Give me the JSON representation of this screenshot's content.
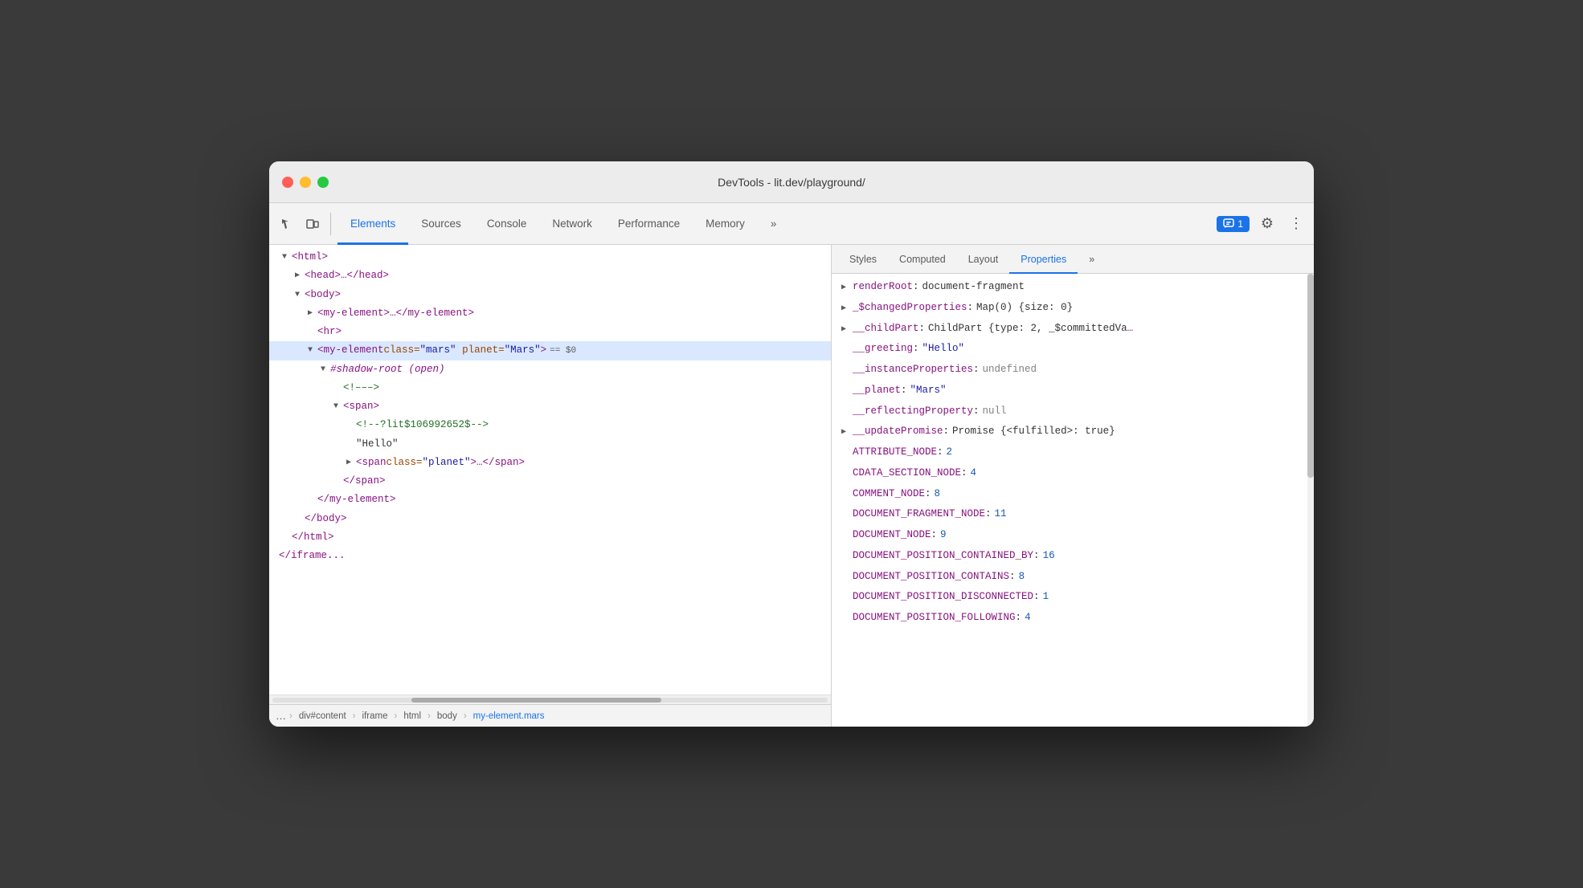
{
  "window": {
    "title": "DevTools - lit.dev/playground/"
  },
  "toolbar": {
    "tabs": [
      {
        "label": "Elements",
        "active": true
      },
      {
        "label": "Sources",
        "active": false
      },
      {
        "label": "Console",
        "active": false
      },
      {
        "label": "Network",
        "active": false
      },
      {
        "label": "Performance",
        "active": false
      },
      {
        "label": "Memory",
        "active": false
      },
      {
        "label": "»",
        "active": false
      }
    ],
    "chat_badge": "1",
    "more_tabs": "»"
  },
  "elements_panel": {
    "tree": [
      {
        "indent": 0,
        "triangle": "▼",
        "content_type": "tag",
        "tag": "html",
        "close": false
      },
      {
        "indent": 1,
        "triangle": "▶",
        "content_type": "tag",
        "tag": "head",
        "text": "<head>…</head>"
      },
      {
        "indent": 1,
        "triangle": "▼",
        "content_type": "tag",
        "tag": "body"
      },
      {
        "indent": 2,
        "triangle": "▶",
        "content_type": "tag",
        "tag": "my-element",
        "text": "<my-element>…</my-element>"
      },
      {
        "indent": 2,
        "triangle": " ",
        "content_type": "tag",
        "tag": "hr"
      },
      {
        "indent": 2,
        "triangle": "▼",
        "content_type": "selected_tag",
        "selected": true
      },
      {
        "indent": 3,
        "triangle": "▼",
        "content_type": "shadow_root"
      },
      {
        "indent": 4,
        "triangle": " ",
        "content_type": "comment",
        "text": "<!–––>"
      },
      {
        "indent": 4,
        "triangle": "▼",
        "content_type": "tag",
        "tag": "span"
      },
      {
        "indent": 5,
        "triangle": " ",
        "content_type": "comment",
        "text": "<!--?lit$106992652$-->"
      },
      {
        "indent": 5,
        "triangle": " ",
        "content_type": "text",
        "text": "\"Hello\""
      },
      {
        "indent": 5,
        "triangle": "▶",
        "content_type": "tag_attr",
        "tag": "span",
        "attr_name": "class",
        "attr_value": "planet",
        "text": "<span class=\"planet\">…</span>"
      },
      {
        "indent": 4,
        "triangle": " ",
        "content_type": "close_tag",
        "tag": "span"
      },
      {
        "indent": 3,
        "triangle": " ",
        "content_type": "close_tag",
        "tag": "my-element"
      },
      {
        "indent": 2,
        "triangle": " ",
        "content_type": "close_tag",
        "tag": "body"
      },
      {
        "indent": 1,
        "triangle": " ",
        "content_type": "close_tag",
        "tag": "html"
      },
      {
        "indent": 0,
        "triangle": " ",
        "content_type": "close_tag_partial",
        "tag": "iframe"
      }
    ],
    "breadcrumb": {
      "items": [
        {
          "label": "…",
          "type": "more"
        },
        {
          "label": "div#content",
          "type": "normal"
        },
        {
          "label": "iframe",
          "type": "normal"
        },
        {
          "label": "html",
          "type": "normal"
        },
        {
          "label": "body",
          "type": "normal"
        },
        {
          "label": "my-element.mars",
          "type": "active"
        }
      ],
      "more_label": "…"
    }
  },
  "properties_panel": {
    "tabs": [
      {
        "label": "Styles",
        "active": false
      },
      {
        "label": "Computed",
        "active": false
      },
      {
        "label": "Layout",
        "active": false
      },
      {
        "label": "Properties",
        "active": true
      },
      {
        "label": "»",
        "active": false
      }
    ],
    "properties": [
      {
        "has_triangle": true,
        "key": "renderRoot",
        "value": "document-fragment",
        "value_type": "plain"
      },
      {
        "has_triangle": true,
        "key": "_$changedProperties",
        "value": "Map(0) {size: 0}",
        "value_type": "plain"
      },
      {
        "has_triangle": true,
        "key": "__childPart",
        "value": "ChildPart {type: 2, _$committedVa…",
        "value_type": "plain"
      },
      {
        "has_triangle": false,
        "key": "__greeting",
        "value": "\"Hello\"",
        "value_type": "string"
      },
      {
        "has_triangle": false,
        "key": "__instanceProperties",
        "value": "undefined",
        "value_type": "null"
      },
      {
        "has_triangle": false,
        "key": "__planet",
        "value": "\"Mars\"",
        "value_type": "string"
      },
      {
        "has_triangle": false,
        "key": "__reflectingProperty",
        "value": "null",
        "value_type": "null"
      },
      {
        "has_triangle": true,
        "key": "__updatePromise",
        "value": "Promise {<fulfilled>: true}",
        "value_type": "plain"
      },
      {
        "has_triangle": false,
        "key": "ATTRIBUTE_NODE",
        "value": "2",
        "value_type": "number"
      },
      {
        "has_triangle": false,
        "key": "CDATA_SECTION_NODE",
        "value": "4",
        "value_type": "number"
      },
      {
        "has_triangle": false,
        "key": "COMMENT_NODE",
        "value": "8",
        "value_type": "number"
      },
      {
        "has_triangle": false,
        "key": "DOCUMENT_FRAGMENT_NODE",
        "value": "11",
        "value_type": "number"
      },
      {
        "has_triangle": false,
        "key": "DOCUMENT_NODE",
        "value": "9",
        "value_type": "number"
      },
      {
        "has_triangle": false,
        "key": "DOCUMENT_POSITION_CONTAINED_BY",
        "value": "16",
        "value_type": "number"
      },
      {
        "has_triangle": false,
        "key": "DOCUMENT_POSITION_CONTAINS",
        "value": "8",
        "value_type": "number"
      },
      {
        "has_triangle": false,
        "key": "DOCUMENT_POSITION_DISCONNECTED",
        "value": "1",
        "value_type": "number"
      },
      {
        "has_triangle": false,
        "key": "DOCUMENT_POSITION_FOLLOWING",
        "value": "4",
        "value_type": "number"
      }
    ]
  }
}
